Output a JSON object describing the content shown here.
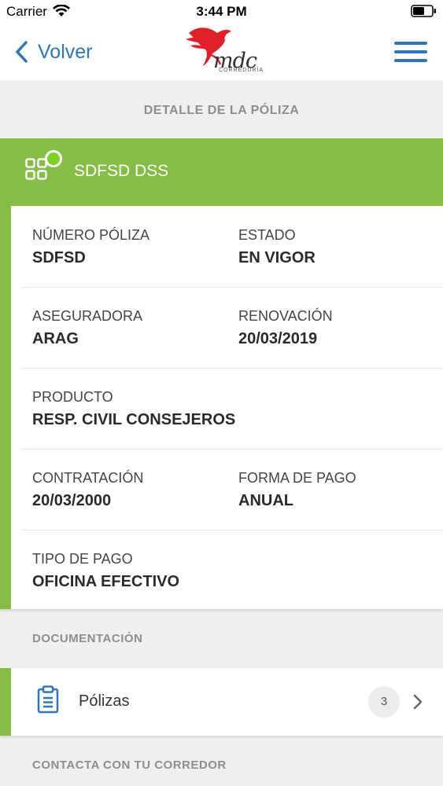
{
  "status_bar": {
    "carrier": "Carrier",
    "time": "3:44 PM"
  },
  "nav": {
    "back_label": "Volver",
    "logo_text": "mdc",
    "logo_subtext": "CORREDURÍA"
  },
  "page_title": "DETALLE DE LA PÓLIZA",
  "policy": {
    "name": "SDFSD DSS",
    "status_color": "#7ed321",
    "accent_color": "#85bd47"
  },
  "details": {
    "numero_label": "NÚMERO PÓLIZA",
    "numero_value": "SDFSD",
    "estado_label": "ESTADO",
    "estado_value": "EN VIGOR",
    "aseguradora_label": "ASEGURADORA",
    "aseguradora_value": "ARAG",
    "renovacion_label": "RENOVACIÓN",
    "renovacion_value": "20/03/2019",
    "producto_label": "PRODUCTO",
    "producto_value": "RESP. CIVIL CONSEJEROS",
    "contratacion_label": "CONTRATACIÓN",
    "contratacion_value": "20/03/2000",
    "forma_pago_label": "FORMA DE PAGO",
    "forma_pago_value": "ANUAL",
    "tipo_pago_label": "TIPO DE PAGO",
    "tipo_pago_value": "OFICINA EFECTIVO"
  },
  "documentation": {
    "title": "DOCUMENTACIÓN",
    "items": [
      {
        "label": "Pólizas",
        "count": "3",
        "icon": "clipboard-icon"
      }
    ]
  },
  "contact": {
    "title": "CONTACTA CON TU CORREDOR"
  }
}
